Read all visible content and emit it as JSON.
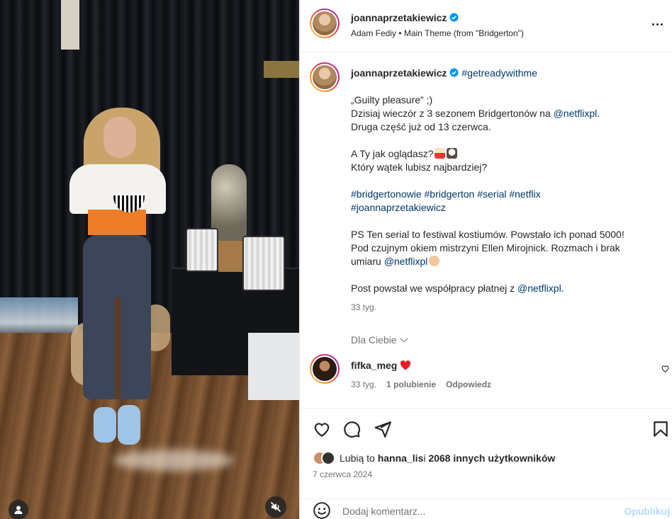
{
  "post": {
    "username": "joannaprzetakiewicz",
    "audio": "Adam Fediy • Main Theme (from \"Bridgerton\")"
  },
  "caption": {
    "hashtag_inline": "#getreadywithme",
    "line1": "„Guilty pleasure” ;)",
    "line2_text": "Dzisiaj wieczór z 3 sezonem Bridgertonów na ",
    "line2_mention": "@netflixpl",
    "line2_end": ".",
    "line3": "Druga część już od 13 czerwca.",
    "line4": "A Ty jak oglądasz?",
    "line5": "Który wątek lubisz najbardziej?",
    "hashtags1": "#bridgertonowie #bridgerton #serial #netflix",
    "hashtags2": "#joannaprzetakiewicz",
    "ps1": "PS Ten serial to festiwal kostiumów. Powstało ich ponad 5000!",
    "ps2": "Pod czujnym okiem mistrzyni Ellen Mirojnick. Rozmach i brak",
    "ps3_text": "umiaru ",
    "ps3_mention": "@netflixpl",
    "collab_text": "Post powstał we współpracy płatnej z ",
    "collab_mention": "@netflixpl",
    "collab_end": ".",
    "time": "33 tyg."
  },
  "for_you": "Dla Ciebie",
  "comment": {
    "username": "fifka_meg",
    "time": "33 tyg.",
    "likes": "1 polubienie",
    "reply": "Odpowiedz"
  },
  "likes": {
    "prefix": "Lubią to ",
    "user": "hanna_lis",
    "middle": " i ",
    "count": "2068 innych użytkowników"
  },
  "date": "7 czerwca 2024",
  "comment_bar": {
    "placeholder": "Dodaj komentarz...",
    "post_label": "Opublikuj"
  },
  "icons": {
    "verified": "verified-badge-icon",
    "more": "more-options-icon",
    "like": "heart-icon",
    "comment": "comment-icon",
    "share": "share-icon",
    "save": "bookmark-icon",
    "emoji": "emoji-icon",
    "mute": "muted-speaker-icon",
    "user_tag": "user-tag-icon"
  },
  "colors": {
    "link": "#00376b",
    "verified": "#0095f6",
    "heart_red": "#ed1c24",
    "post_disabled": "#b3dbff"
  }
}
